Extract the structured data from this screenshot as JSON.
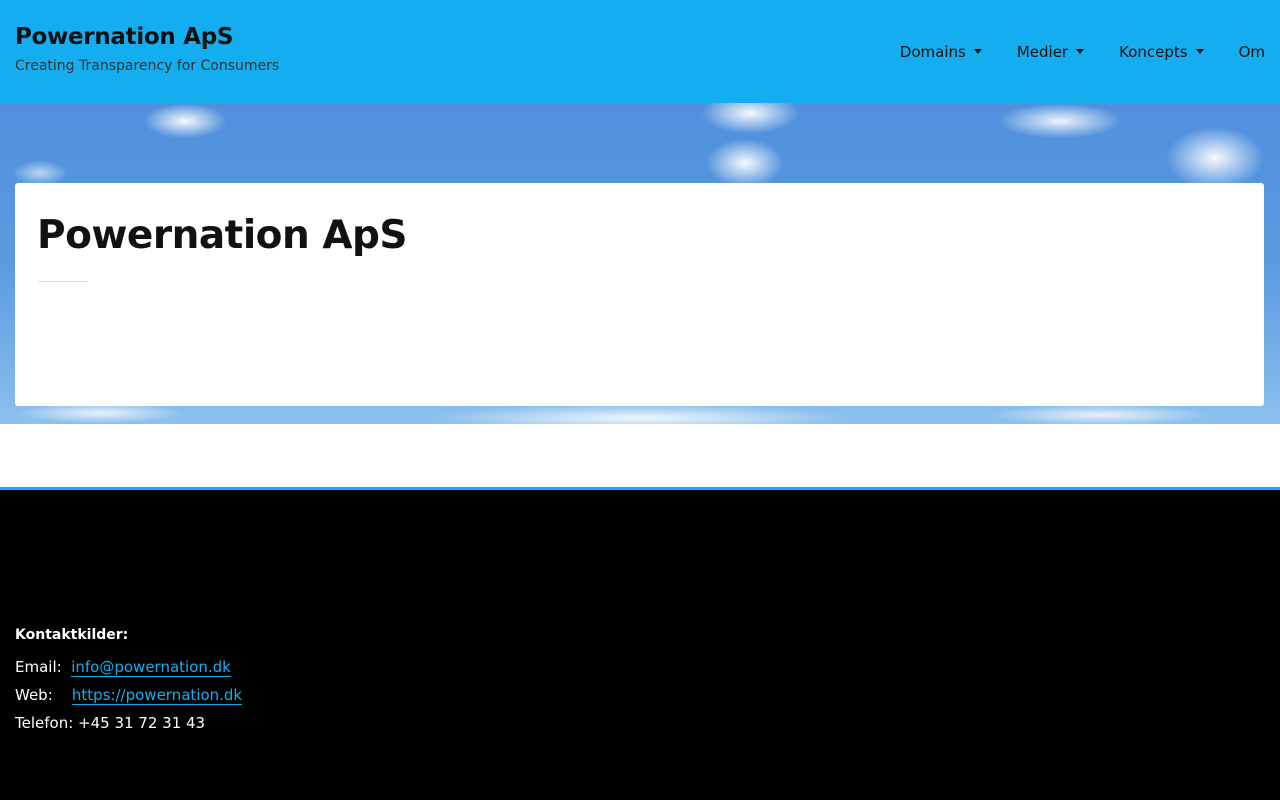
{
  "header": {
    "brand_title": "Powernation ApS",
    "brand_tagline": "Creating Transparency for Consumers",
    "nav": [
      {
        "label": "Domains",
        "has_dropdown": true
      },
      {
        "label": "Medier",
        "has_dropdown": true
      },
      {
        "label": "Koncepts",
        "has_dropdown": true
      },
      {
        "label": "Om",
        "has_dropdown": false
      }
    ]
  },
  "main": {
    "title": "Powernation ApS"
  },
  "footer": {
    "contact_heading": "Kontaktkilder:",
    "email_label": "Email:",
    "email_value": "info@powernation.dk",
    "web_label": "Web:",
    "web_value": "https://powernation.dk",
    "phone_text": "Telefon: +45 31 72 31 43"
  },
  "colors": {
    "accent": "#14aef0",
    "footer_bg": "#000000"
  }
}
